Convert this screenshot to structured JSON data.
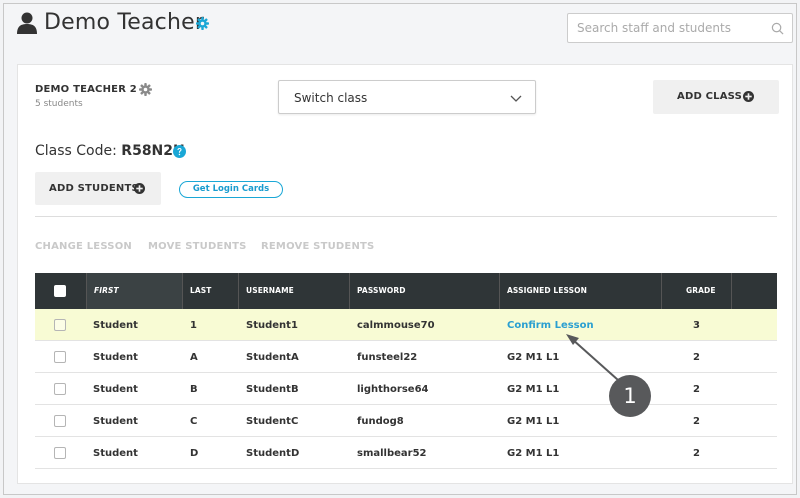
{
  "header": {
    "teacher_name": "Demo Teacher",
    "search_placeholder": "Search staff and students"
  },
  "class_panel": {
    "class_name": "DEMO TEACHER 2",
    "student_count": "5 students",
    "switch_class_label": "Switch class",
    "add_class_label": "ADD CLASS",
    "class_code_label": "Class Code:",
    "class_code_value": "R58N2H",
    "add_students_label": "ADD STUDENTS",
    "login_cards_label": "Get Login Cards"
  },
  "actions": {
    "change_lesson": "CHANGE LESSON",
    "move_students": "MOVE STUDENTS",
    "remove_students": "REMOVE STUDENTS"
  },
  "table": {
    "columns": [
      "FIRST",
      "LAST",
      "USERNAME",
      "PASSWORD",
      "ASSIGNED LESSON",
      "GRADE"
    ],
    "rows": [
      {
        "first": "Student",
        "last": "1",
        "username": "Student1",
        "password": "calmmouse70",
        "lesson": "Confirm Lesson",
        "grade": "3",
        "highlighted": true
      },
      {
        "first": "Student",
        "last": "A",
        "username": "StudentA",
        "password": "funsteel22",
        "lesson": "G2 M1 L1",
        "grade": "2"
      },
      {
        "first": "Student",
        "last": "B",
        "username": "StudentB",
        "password": "lighthorse64",
        "lesson": "G2 M1 L1",
        "grade": "2"
      },
      {
        "first": "Student",
        "last": "C",
        "username": "StudentC",
        "password": "fundog8",
        "lesson": "G2 M1 L1",
        "grade": "2"
      },
      {
        "first": "Student",
        "last": "D",
        "username": "StudentD",
        "password": "smallbear52",
        "lesson": "G2 M1 L1",
        "grade": "2"
      }
    ]
  },
  "callout": {
    "number": "1"
  },
  "icons": {
    "user": "user-icon",
    "settings": "gear-icon",
    "search": "search-icon",
    "dropdown": "chevron-down-icon",
    "add": "plus-circle-icon",
    "help": "question-circle-icon"
  },
  "colors": {
    "accent": "#1aa7d6",
    "header_dark": "#2f3537",
    "highlight_row": "#f8fbd4",
    "callout": "#58595b"
  }
}
